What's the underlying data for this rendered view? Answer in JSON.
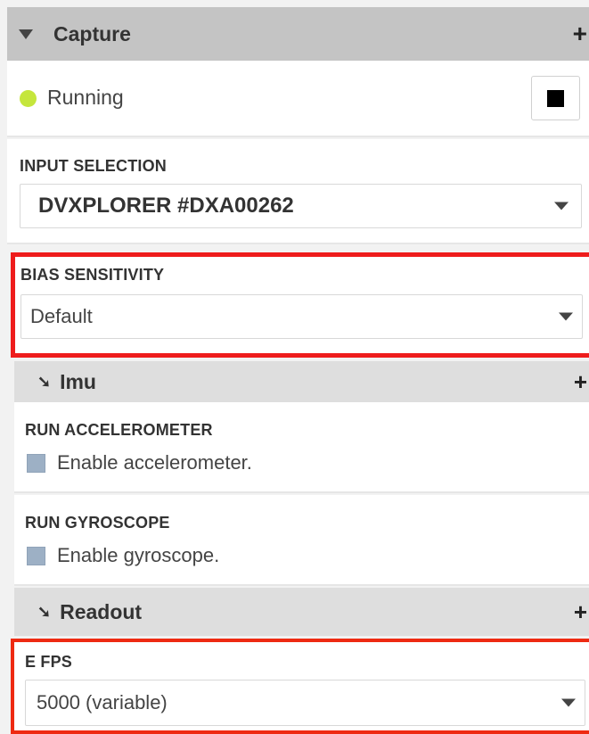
{
  "capture": {
    "title": "Capture",
    "add_symbol": "+",
    "status": "Running",
    "status_color": "#c5e63c"
  },
  "input_selection": {
    "label": "INPUT SELECTION",
    "value": "DVXPLORER #DXA00262"
  },
  "bias_sensitivity": {
    "label": "BIAS SENSITIVITY",
    "value": "Default"
  },
  "imu": {
    "title": "Imu",
    "arrow": "➘",
    "add_symbol": "+",
    "accelerometer": {
      "label": "RUN ACCELEROMETER",
      "checkbox_text": "Enable accelerometer.",
      "checked": false
    },
    "gyroscope": {
      "label": "RUN GYROSCOPE",
      "checkbox_text": "Enable gyroscope.",
      "checked": false
    }
  },
  "readout": {
    "title": "Readout",
    "arrow": "➘",
    "add_symbol": "+",
    "e_fps": {
      "label": "E FPS",
      "value": "5000 (variable)"
    }
  },
  "highlight_color": "#ee1c1c"
}
